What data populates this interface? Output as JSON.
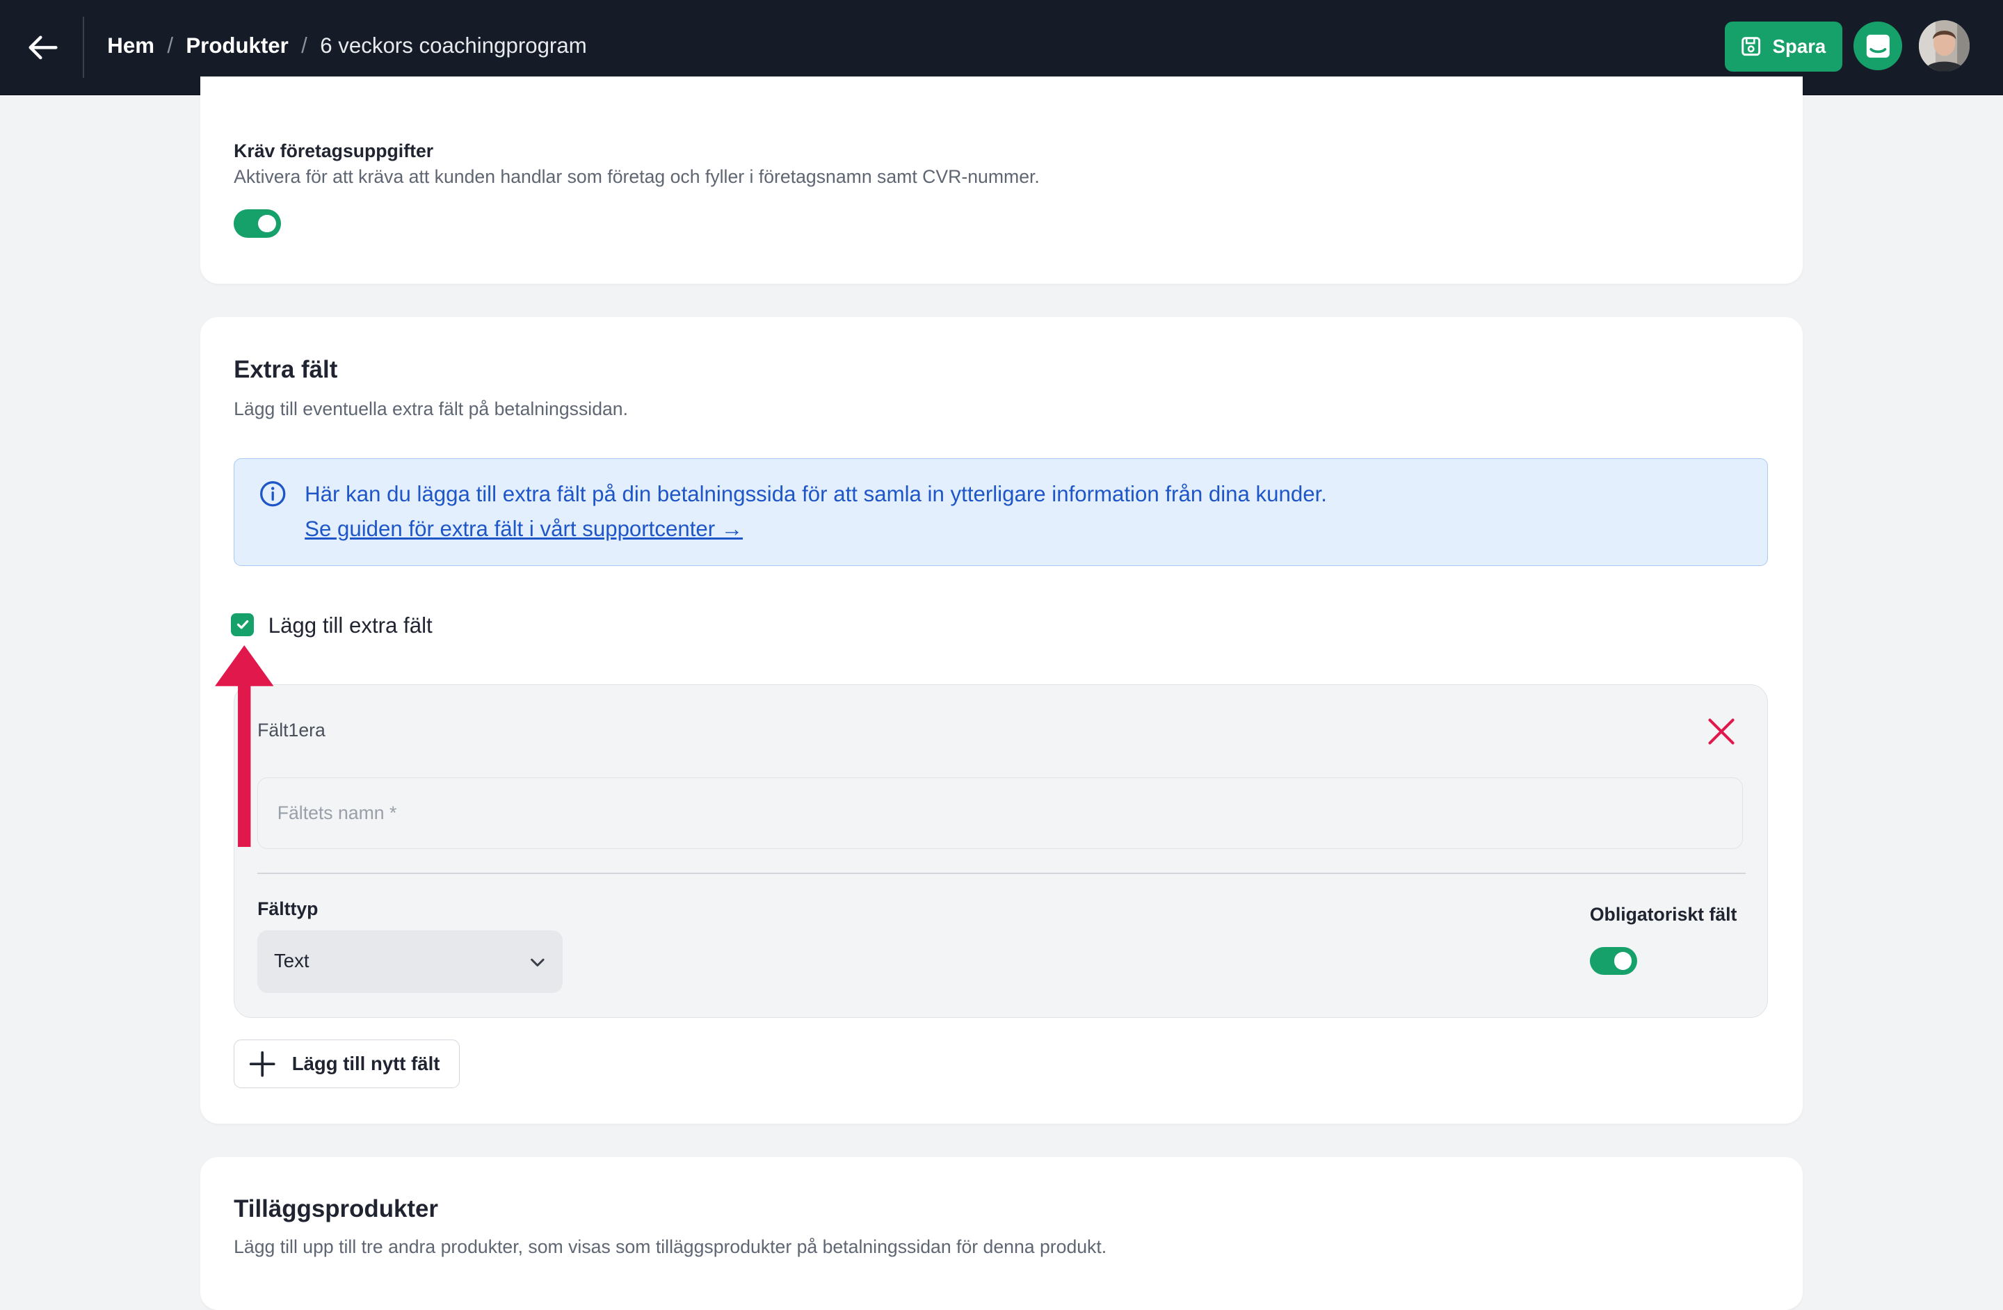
{
  "header": {
    "breadcrumbs": [
      "Hem",
      "Produkter",
      "6 veckors coachingprogram"
    ],
    "separator": "/",
    "save_label": "Spara"
  },
  "company": {
    "title": "Kräv företagsuppgifter",
    "description": "Aktivera för att kräva att kunden handlar som företag och fyller i företagsnamn samt CVR-nummer.",
    "toggle_on": true
  },
  "extra_fields": {
    "title": "Extra fält",
    "subtitle": "Lägg till eventuella extra fält på betalningssidan.",
    "info_text": "Här kan du lägga till extra fält på din betalningssida för att samla in ytterligare information från dina kunder.",
    "info_link": "Se guiden för extra fält i vårt supportcenter →",
    "checkbox_label": "Lägg till extra fält",
    "checkbox_checked": true,
    "field": {
      "title": "Fält1era",
      "name_placeholder": "Fältets namn *",
      "name_value": "",
      "type_label": "Fälttyp",
      "type_value": "Text",
      "required_label": "Obligatoriskt fält",
      "required_on": true
    },
    "add_button": "Lägg till nytt fält"
  },
  "addons": {
    "title": "Tilläggsprodukter",
    "subtitle": "Lägg till upp till tre andra produkter, som visas som tilläggsprodukter på betalningssidan för denna produkt."
  },
  "colors": {
    "accent": "#16a06a",
    "topbar": "#151c27",
    "info_bg": "#e3effd",
    "info_text": "#1f56c7",
    "annotation_arrow": "#e0184c",
    "delete": "#e0184c"
  }
}
